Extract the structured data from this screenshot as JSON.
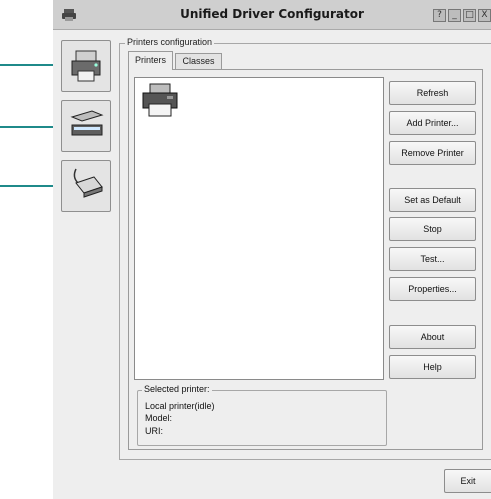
{
  "window": {
    "title": "Unified Driver Configurator",
    "controls": {
      "help": "?",
      "minimize": "_",
      "maximize": "□",
      "close": "X"
    }
  },
  "sidebar": {
    "items": [
      {
        "name": "printers",
        "icon": "printer-icon"
      },
      {
        "name": "scanners",
        "icon": "scanner-icon"
      },
      {
        "name": "ports",
        "icon": "port-icon"
      }
    ]
  },
  "group": {
    "title": "Printers configuration"
  },
  "tabs": [
    {
      "label": "Printers",
      "active": true
    },
    {
      "label": "Classes",
      "active": false
    }
  ],
  "printer_list": {
    "items": [
      {
        "icon": "printer-icon",
        "label": ""
      }
    ]
  },
  "actions": {
    "refresh": "Refresh",
    "add_printer": "Add Printer...",
    "remove_printer": "Remove Printer",
    "set_default": "Set as Default",
    "stop": "Stop",
    "test": "Test...",
    "properties": "Properties...",
    "about": "About",
    "help": "Help"
  },
  "selected_printer": {
    "title": "Selected printer:",
    "status": "Local printer(idle)",
    "model": "Model:",
    "uri": "URI:"
  },
  "footer": {
    "exit": "Exit"
  },
  "colors": {
    "callout": "#1f8a8a",
    "titlebar": "#cfcfcf",
    "window_bg": "#eeeeee"
  }
}
